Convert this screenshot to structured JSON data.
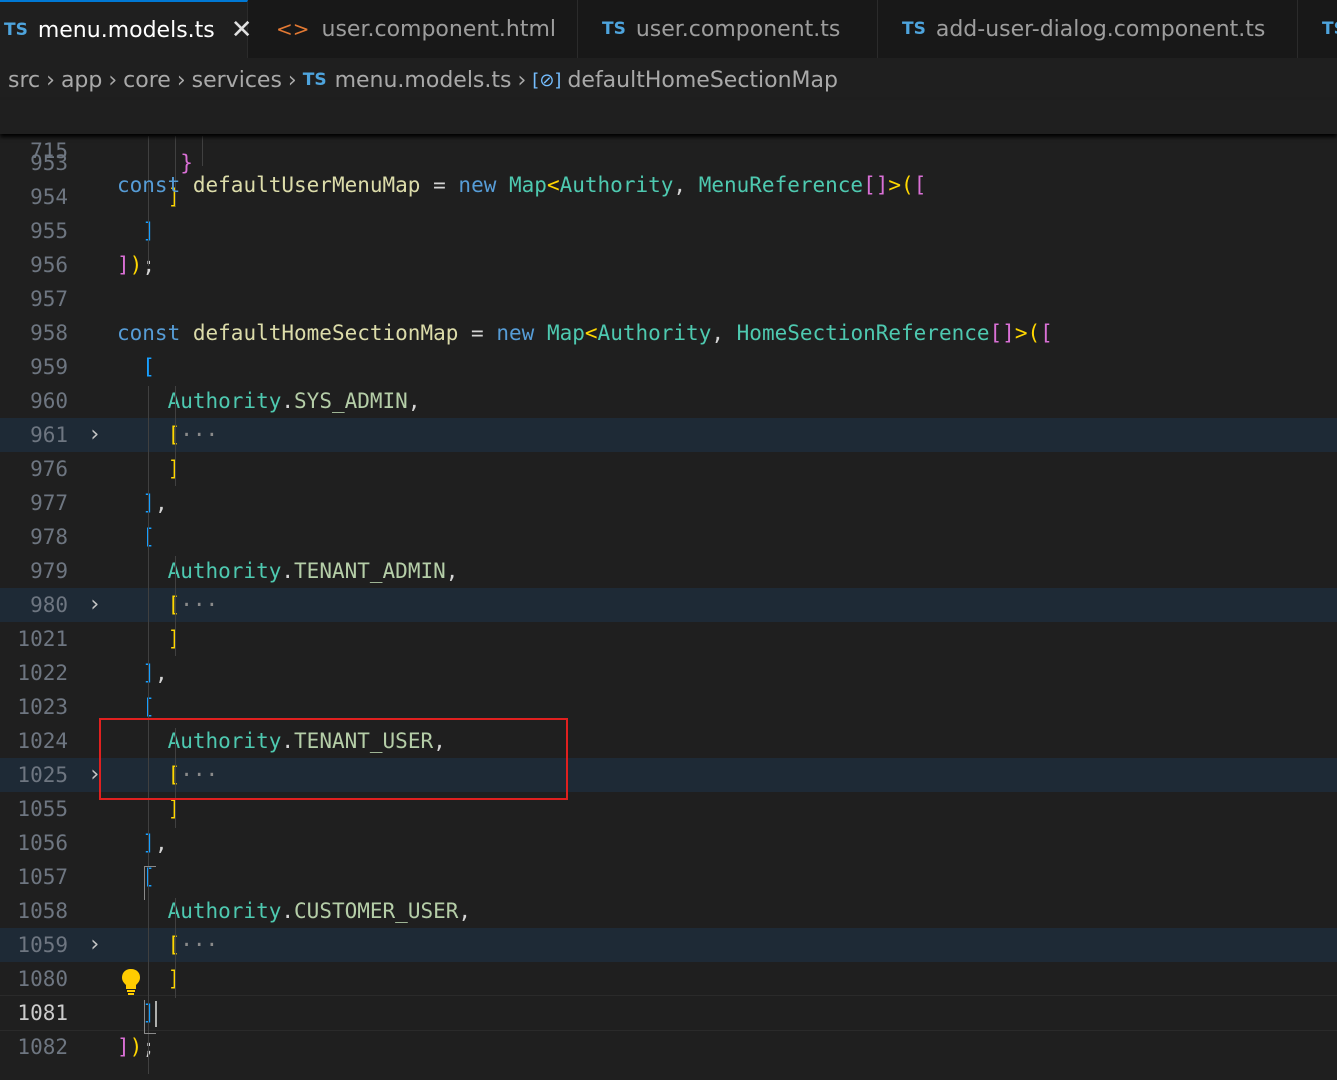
{
  "tabs": [
    {
      "lang": "TS",
      "label": "menu.models.ts",
      "close": "✕"
    },
    {
      "lang": "<>",
      "label": "user.component.html"
    },
    {
      "lang": "TS",
      "label": "user.component.ts"
    },
    {
      "lang": "TS",
      "label": "add-user-dialog.component.ts"
    },
    {
      "lang": "TS",
      "label": ""
    }
  ],
  "breadcrumb": {
    "p1": "src",
    "p2": "app",
    "p3": "core",
    "p4": "services",
    "file_lang": "TS",
    "file": "menu.models.ts",
    "symbol_icon": "[⊘]",
    "symbol": "defaultHomeSectionMap"
  },
  "sticky": {
    "line": "715",
    "kw": "const",
    "name": "defaultUserMenuMap",
    "eq": "=",
    "new": "new",
    "map": "Map",
    "t1": "Authority",
    "comma": ",",
    "t2": "MenuReference"
  },
  "lines": {
    "l953": "953",
    "l954": "954",
    "l955": "955",
    "l956": "956",
    "l957": "957",
    "l958": "958",
    "l959": "959",
    "l960": "960",
    "l961": "961",
    "l976": "976",
    "l977": "977",
    "l978": "978",
    "l979": "979",
    "l980": "980",
    "l1021": "1021",
    "l1022": "1022",
    "l1023": "1023",
    "l1024": "1024",
    "l1025": "1025",
    "l1055": "1055",
    "l1056": "1056",
    "l1057": "1057",
    "l1058": "1058",
    "l1059": "1059",
    "l1080": "1080",
    "l1081": "1081",
    "l1082": "1082"
  },
  "code": {
    "const": "const",
    "home_map": "defaultHomeSectionMap",
    "eq": "=",
    "new": "new",
    "map": "Map",
    "authority": "Authority",
    "home_ref": "HomeSectionReference",
    "sys_admin": "SYS_ADMIN",
    "tenant_admin": "TENANT_ADMIN",
    "tenant_user": "TENANT_USER",
    "customer_user": "CUSTOMER_USER",
    "ellipsis": "···"
  },
  "icons": {
    "chevron": "chevron-right-icon",
    "bulb": "lightbulb-icon",
    "close": "close-icon",
    "ts": "typescript-file-icon",
    "html": "html-file-icon"
  },
  "colors": {
    "annotation": "#e0201f",
    "keyword": "#569cd6",
    "identifier": "#dcdcaa",
    "type": "#4ec9b0",
    "property": "#b5cea8"
  }
}
